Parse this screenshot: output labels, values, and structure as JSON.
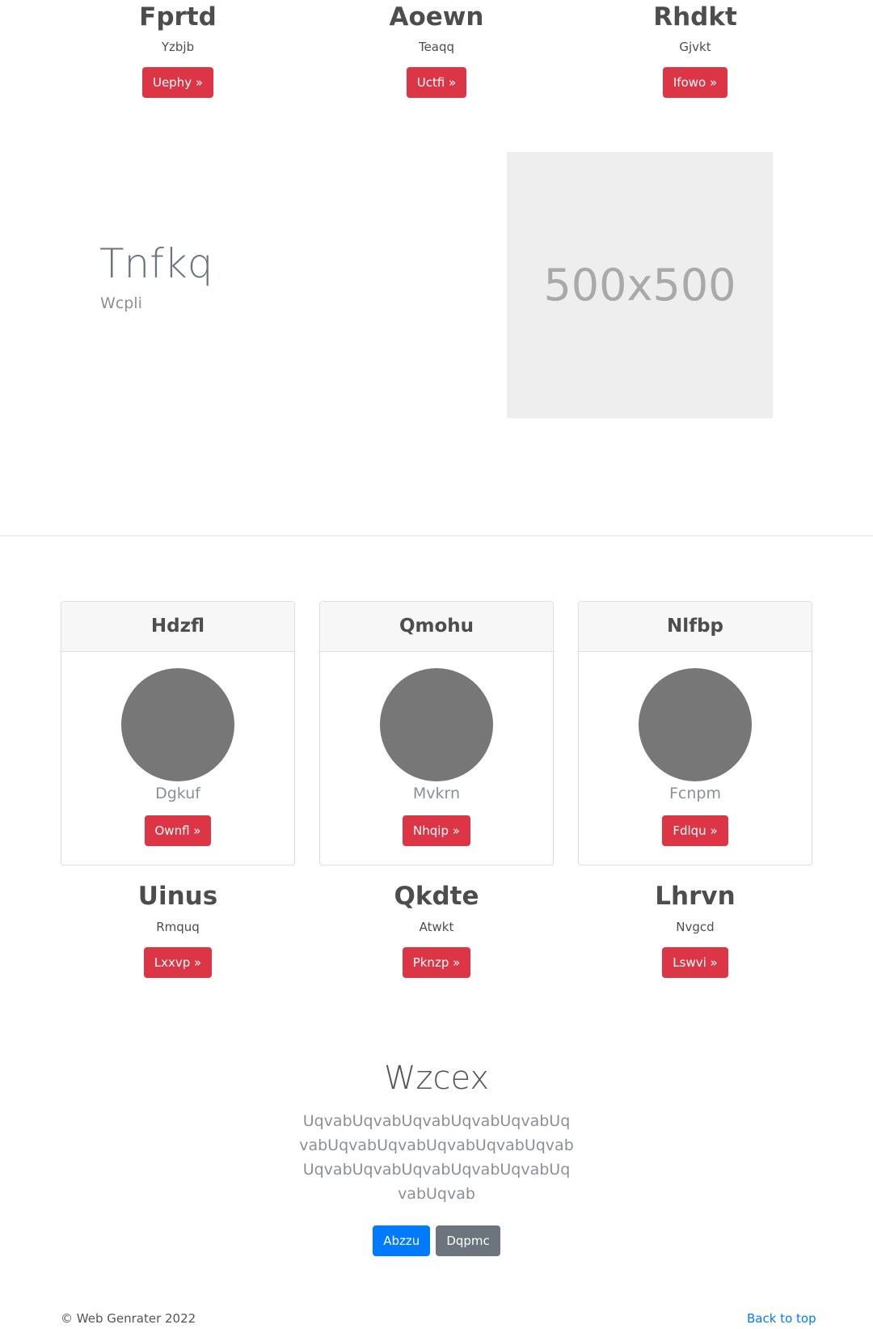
{
  "top_features": [
    {
      "title": "Fprtd",
      "subtitle": "Yzbjb",
      "button": "Uephy »"
    },
    {
      "title": "Aoewn",
      "subtitle": "Teaqq",
      "button": "Uctfi »"
    },
    {
      "title": "Rhdkt",
      "subtitle": "Gjvkt",
      "button": "Ifowo »"
    }
  ],
  "hero": {
    "title": "Tnfkq",
    "subtitle": "Wcpli",
    "image_placeholder": "500x500"
  },
  "cards": [
    {
      "header": "Hdzfl",
      "label": "Dgkuf",
      "button": "Ownfl »"
    },
    {
      "header": "Qmohu",
      "label": "Mvkrn",
      "button": "Nhqip »"
    },
    {
      "header": "Nlfbp",
      "label": "Fcnpm",
      "button": "Fdlqu »"
    }
  ],
  "bottom_features": [
    {
      "title": "Uinus",
      "subtitle": "Rmquq",
      "button": "Lxxvp »"
    },
    {
      "title": "Qkdte",
      "subtitle": "Atwkt",
      "button": "Pknzp »"
    },
    {
      "title": "Lhrvn",
      "subtitle": "Nvgcd",
      "button": "Lswvi »"
    }
  ],
  "jumbotron": {
    "title": "Wzcex",
    "paragraph": "UqvabUqvabUqvabUqvabUqvabUqvabUqvabUqvabUqvabUqvabUqvabUqvabUqvabUqvabUqvabUqvabUqvabUqvab",
    "primary_button": "Abzzu",
    "secondary_button": "Dqpmc"
  },
  "footer": {
    "copyright": "© Web Genrater 2022",
    "back_to_top": "Back to top"
  },
  "colors": {
    "danger": "#dc3545",
    "primary": "#007bff",
    "secondary": "#6c757d"
  }
}
